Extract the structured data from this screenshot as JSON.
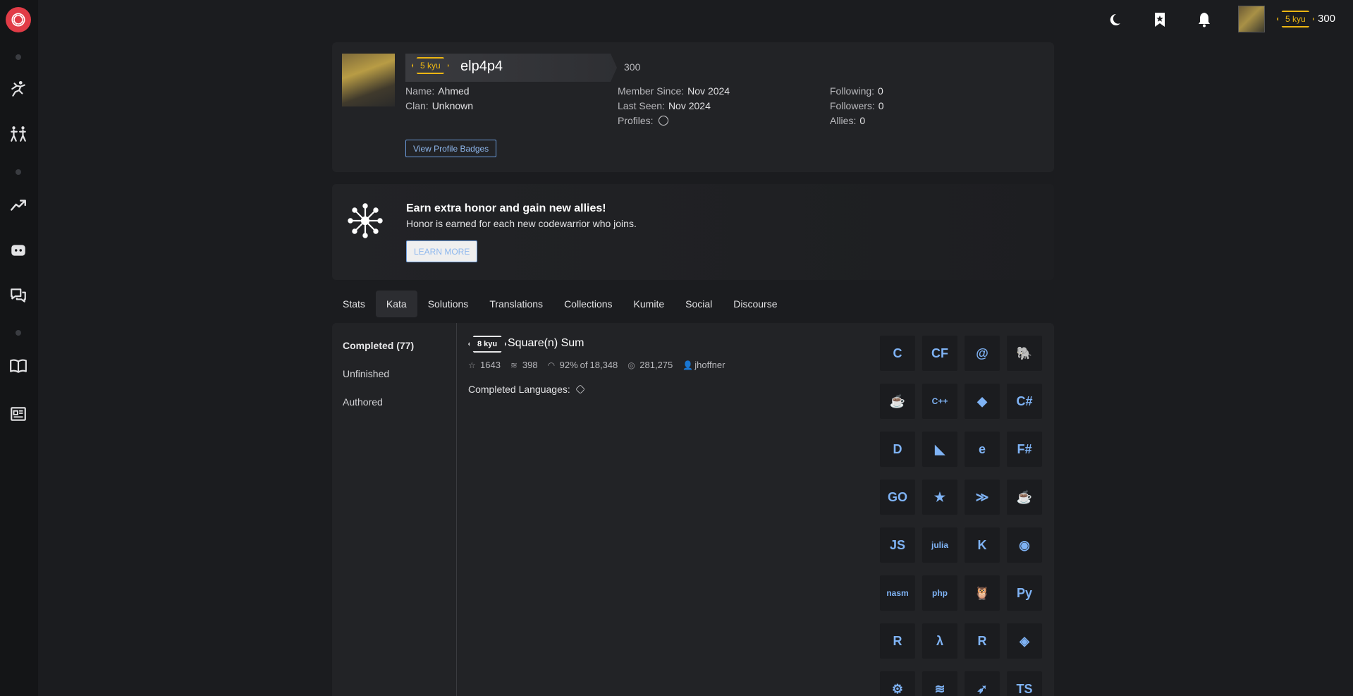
{
  "topbar": {
    "rank": "5 kyu",
    "honor": "300"
  },
  "profile": {
    "rank": "5 kyu",
    "username": "elp4p4",
    "honor": "300",
    "name_label": "Name:",
    "name": "Ahmed",
    "clan_label": "Clan:",
    "clan": "Unknown",
    "member_since_label": "Member Since:",
    "member_since": "Nov 2024",
    "last_seen_label": "Last Seen:",
    "last_seen": "Nov 2024",
    "profiles_label": "Profiles:",
    "following_label": "Following:",
    "following": "0",
    "followers_label": "Followers:",
    "followers": "0",
    "allies_label": "Allies:",
    "allies": "0",
    "badges_button": "View Profile Badges"
  },
  "promo": {
    "title": "Earn extra honor and gain new allies!",
    "subtitle": "Honor is earned for each new codewarrior who joins.",
    "button": "LEARN MORE"
  },
  "tabs": [
    {
      "label": "Stats"
    },
    {
      "label": "Kata",
      "active": true
    },
    {
      "label": "Solutions"
    },
    {
      "label": "Translations"
    },
    {
      "label": "Collections"
    },
    {
      "label": "Kumite"
    },
    {
      "label": "Social"
    },
    {
      "label": "Discourse"
    }
  ],
  "filters": [
    {
      "label": "Completed (77)",
      "active": true
    },
    {
      "label": "Unfinished"
    },
    {
      "label": "Authored"
    }
  ],
  "kata": {
    "rank": "8 kyu",
    "title": "Square(n) Sum",
    "stars": "1643",
    "collections": "398",
    "satisfaction_pct": "92%",
    "satisfaction_of": "of",
    "satisfaction_votes": "18,348",
    "completions": "281,275",
    "author": "jhoffner",
    "completed_languages_label": "Completed Languages:"
  },
  "languages": [
    {
      "name": "c-icon",
      "text": "C"
    },
    {
      "name": "cfml-icon",
      "text": "CF"
    },
    {
      "name": "clojure-icon",
      "text": "@"
    },
    {
      "name": "cobol-icon",
      "text": "🐘"
    },
    {
      "name": "coffeescript-icon",
      "text": "☕"
    },
    {
      "name": "cpp-icon",
      "text": "C++"
    },
    {
      "name": "crystal-icon",
      "text": "◆"
    },
    {
      "name": "csharp-icon",
      "text": "C#"
    },
    {
      "name": "d-icon",
      "text": "D"
    },
    {
      "name": "dart-icon",
      "text": "◣"
    },
    {
      "name": "elixir-icon",
      "text": "e"
    },
    {
      "name": "fsharp-icon",
      "text": "F#"
    },
    {
      "name": "go-icon",
      "text": "GO"
    },
    {
      "name": "groovy-icon",
      "text": "★"
    },
    {
      "name": "haskell-icon",
      "text": "≫"
    },
    {
      "name": "java-icon",
      "text": "☕"
    },
    {
      "name": "javascript-icon",
      "text": "JS"
    },
    {
      "name": "julia-icon",
      "text": "julia"
    },
    {
      "name": "kotlin-icon",
      "text": "K"
    },
    {
      "name": "lua-icon",
      "text": "◉"
    },
    {
      "name": "nasm-icon",
      "text": "nasm"
    },
    {
      "name": "php-icon",
      "text": "php"
    },
    {
      "name": "prolog-icon",
      "text": "🦉"
    },
    {
      "name": "python-icon",
      "text": "Py"
    },
    {
      "name": "r-icon",
      "text": "R"
    },
    {
      "name": "racket-icon",
      "text": "λ"
    },
    {
      "name": "raku-icon",
      "text": "R"
    },
    {
      "name": "ruby-icon",
      "text": "◈"
    },
    {
      "name": "rust-icon",
      "text": "⚙"
    },
    {
      "name": "scala-icon",
      "text": "≋"
    },
    {
      "name": "swift-icon",
      "text": "➶"
    },
    {
      "name": "typescript-icon",
      "text": "TS"
    }
  ],
  "colors": {
    "accent": "#ecb613",
    "brand": "#e13c47",
    "link": "#8fb8ee",
    "background": "#1b1c1f",
    "panel": "#222326"
  }
}
